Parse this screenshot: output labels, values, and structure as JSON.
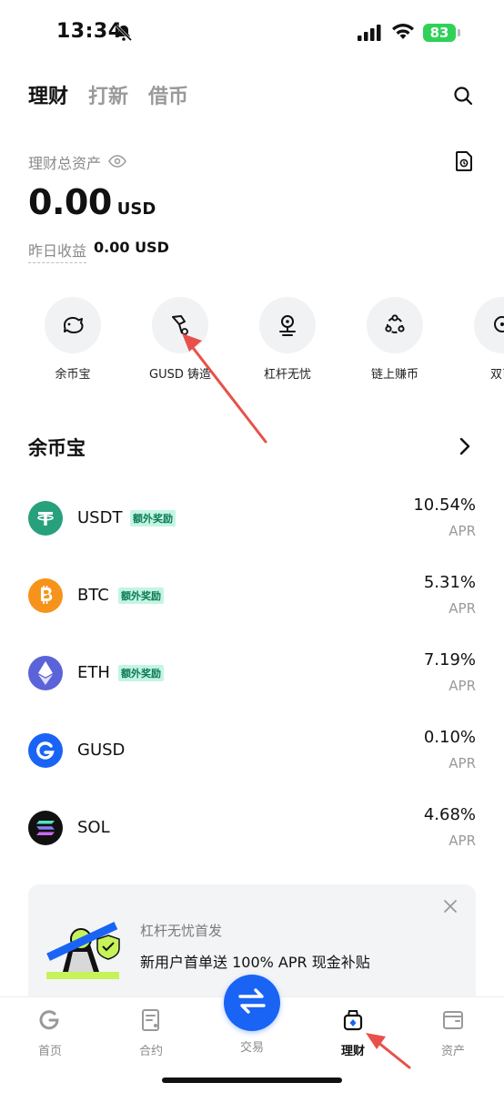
{
  "status_bar": {
    "time": "13:34",
    "battery": "83",
    "icons": [
      "bell-slash-icon",
      "signal-icon",
      "wifi-icon",
      "battery-icon"
    ]
  },
  "header": {
    "tabs": [
      {
        "label": "理财",
        "active": true
      },
      {
        "label": "打新",
        "active": false
      },
      {
        "label": "借币",
        "active": false
      }
    ],
    "search_icon": "search-icon"
  },
  "assets": {
    "label": "理财总资产",
    "value": "0.00",
    "unit": "USD",
    "yesterday_label": "昨日收益",
    "yesterday_value": "0.00 USD"
  },
  "quick_products": [
    {
      "label": "余币宝",
      "icon": "piggy-bank-icon"
    },
    {
      "label": "GUSD 铸造",
      "icon": "hammer-icon"
    },
    {
      "label": "杠杆无忧",
      "icon": "leverage-icon"
    },
    {
      "label": "链上赚币",
      "icon": "onchain-icon"
    },
    {
      "label": "双币",
      "icon": "dual-coin-icon"
    }
  ],
  "section": {
    "title": "余币宝"
  },
  "coins": [
    {
      "name": "USDT",
      "badge": "额外奖励",
      "rate": "10.54%",
      "apr": "APR",
      "color": "#26a17b",
      "symbol": "T"
    },
    {
      "name": "BTC",
      "badge": "额外奖励",
      "rate": "5.31%",
      "apr": "APR",
      "color": "#f7931a",
      "symbol": "B"
    },
    {
      "name": "ETH",
      "badge": "额外奖励",
      "rate": "7.19%",
      "apr": "APR",
      "color": "#5b63d8",
      "symbol": "◆"
    },
    {
      "name": "GUSD",
      "badge": "",
      "rate": "0.10%",
      "apr": "APR",
      "color": "#1a64f5",
      "symbol": "G"
    },
    {
      "name": "SOL",
      "badge": "",
      "rate": "4.68%",
      "apr": "APR",
      "color": "#111111",
      "symbol": "≡"
    }
  ],
  "promo": {
    "title": "杠杆无忧首发",
    "description": "新用户首单送 100% APR 现金补贴"
  },
  "bottom_nav": {
    "items": [
      {
        "label": "首页",
        "icon": "home-icon",
        "active": false
      },
      {
        "label": "合约",
        "icon": "contract-icon",
        "active": false
      },
      {
        "label": "交易",
        "icon": "swap-icon",
        "active": false
      },
      {
        "label": "理财",
        "icon": "earn-icon",
        "active": true
      },
      {
        "label": "资产",
        "icon": "wallet-icon",
        "active": false
      }
    ]
  },
  "colors": {
    "accent_blue": "#1a64f5",
    "badge_bg": "#c4f5e4",
    "badge_text": "#0b7a52",
    "annotation_red": "#e8514a"
  }
}
